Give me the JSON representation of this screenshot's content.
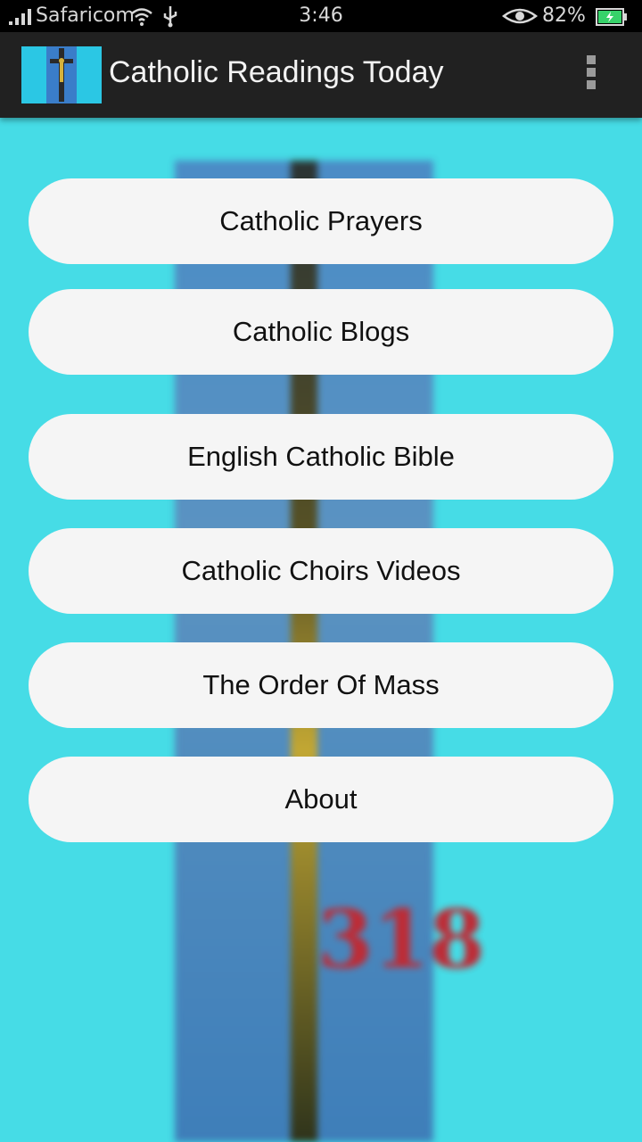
{
  "status_bar": {
    "carrier": "Safaricom",
    "time": "3:46",
    "battery_percent": "82%"
  },
  "app_bar": {
    "title": "Catholic Readings Today",
    "menu_icon": "overflow-menu-icon"
  },
  "background_image": {
    "overlay_number": "318"
  },
  "menu": {
    "items": [
      "Catholic Prayers",
      "Catholic Blogs",
      "English Catholic Bible",
      "Catholic Choirs Videos",
      "The Order Of Mass",
      "About"
    ]
  },
  "colors": {
    "background": "#46dce6",
    "app_bar": "#212121",
    "button": "#f5f5f5",
    "battery_green": "#37d26a"
  }
}
